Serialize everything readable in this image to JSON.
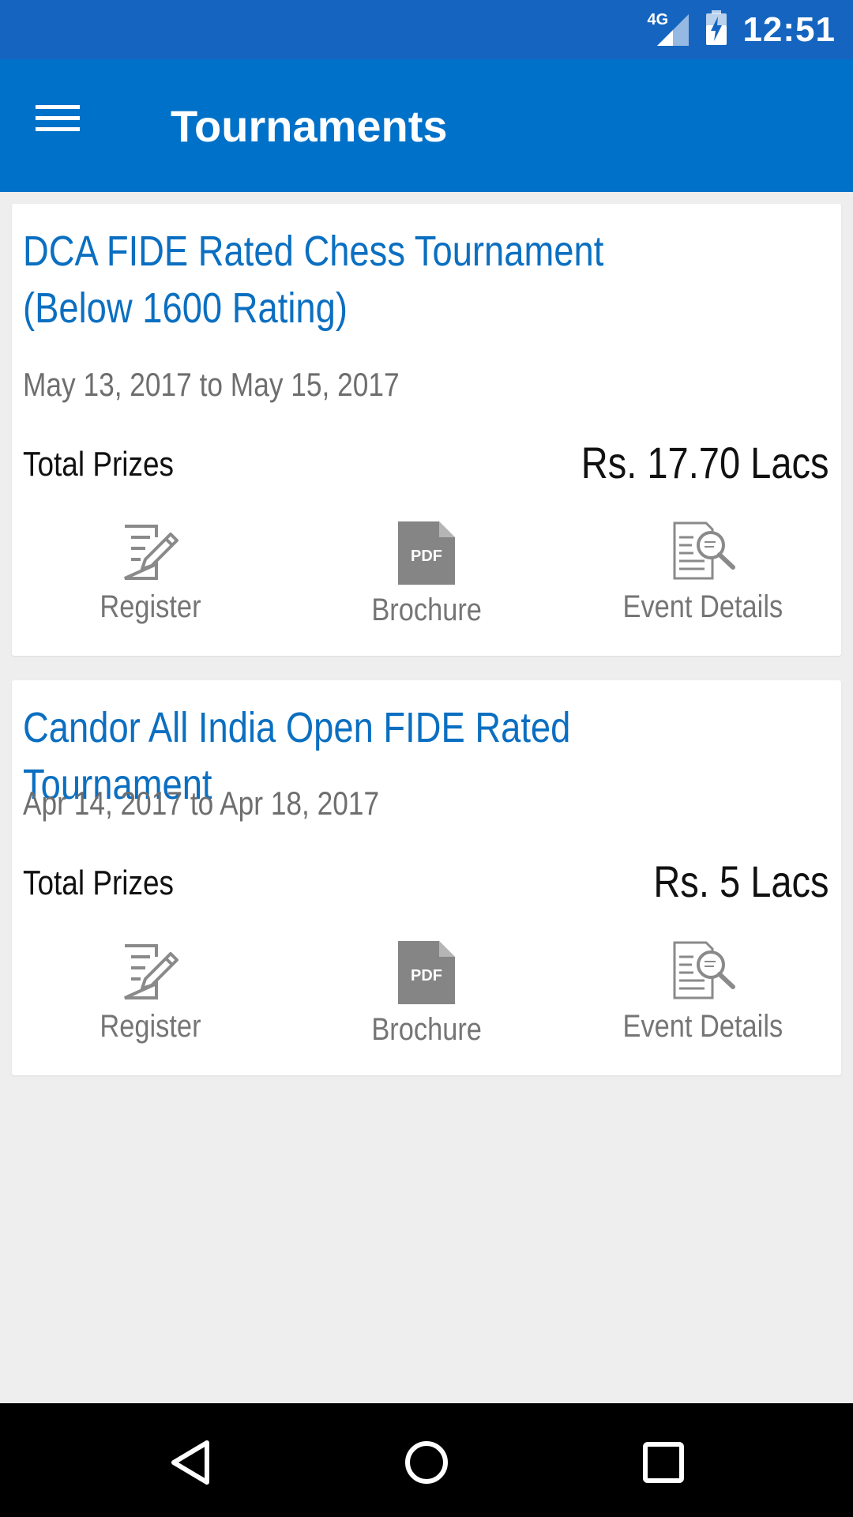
{
  "status_bar": {
    "network": "4G",
    "time": "12:51",
    "signal_icon": "cell-signal-icon",
    "battery_icon": "battery-charging-icon"
  },
  "app_bar": {
    "menu_icon": "hamburger-menu-icon",
    "title": "Tournaments"
  },
  "colors": {
    "status_bar": "#1565c0",
    "app_bar": "#0071c9",
    "title_blue": "#0b6fc1",
    "background": "#eeeeee"
  },
  "tournaments": [
    {
      "title": "DCA FIDE Rated Chess Tournament (Below 1600 Rating)",
      "dates": "May 13, 2017 to May 15, 2017",
      "prize_label": "Total Prizes",
      "prize_value": "Rs. 17.70 Lacs",
      "actions": [
        {
          "label": "Register",
          "icon": "register-edit-icon"
        },
        {
          "label": "Brochure",
          "icon": "pdf-icon",
          "icon_text": "PDF"
        },
        {
          "label": "Event Details",
          "icon": "document-search-icon"
        }
      ]
    },
    {
      "title": "Candor All India Open FIDE Rated Tournament",
      "dates": "Apr 14, 2017 to Apr 18, 2017",
      "prize_label": "Total Prizes",
      "prize_value": "Rs. 5 Lacs",
      "actions": [
        {
          "label": "Register",
          "icon": "register-edit-icon"
        },
        {
          "label": "Brochure",
          "icon": "pdf-icon",
          "icon_text": "PDF"
        },
        {
          "label": "Event Details",
          "icon": "document-search-icon"
        }
      ]
    }
  ],
  "nav_bar": {
    "back": "back-triangle-icon",
    "home": "home-circle-icon",
    "recents": "recents-square-icon"
  }
}
